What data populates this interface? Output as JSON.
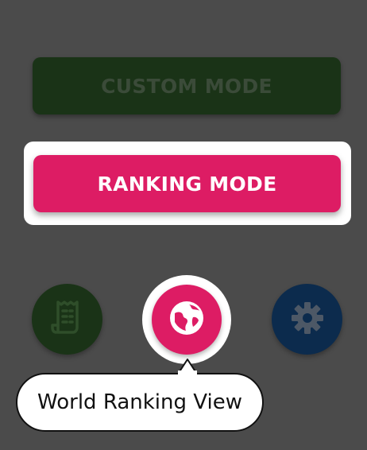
{
  "buttons": {
    "custom_mode_label": "CUSTOM MODE",
    "ranking_mode_label": "RANKING MODE"
  },
  "icons": {
    "history": "receipt-icon",
    "world": "globe-icon",
    "settings": "gear-icon"
  },
  "tooltip": {
    "text": "World Ranking View"
  },
  "colors": {
    "background": "#4b4b4b",
    "custom_mode_bg": "#1a3317",
    "accent_pink": "#dd1c64",
    "settings_bg": "#0c2b4d",
    "highlight": "#ffffff"
  }
}
